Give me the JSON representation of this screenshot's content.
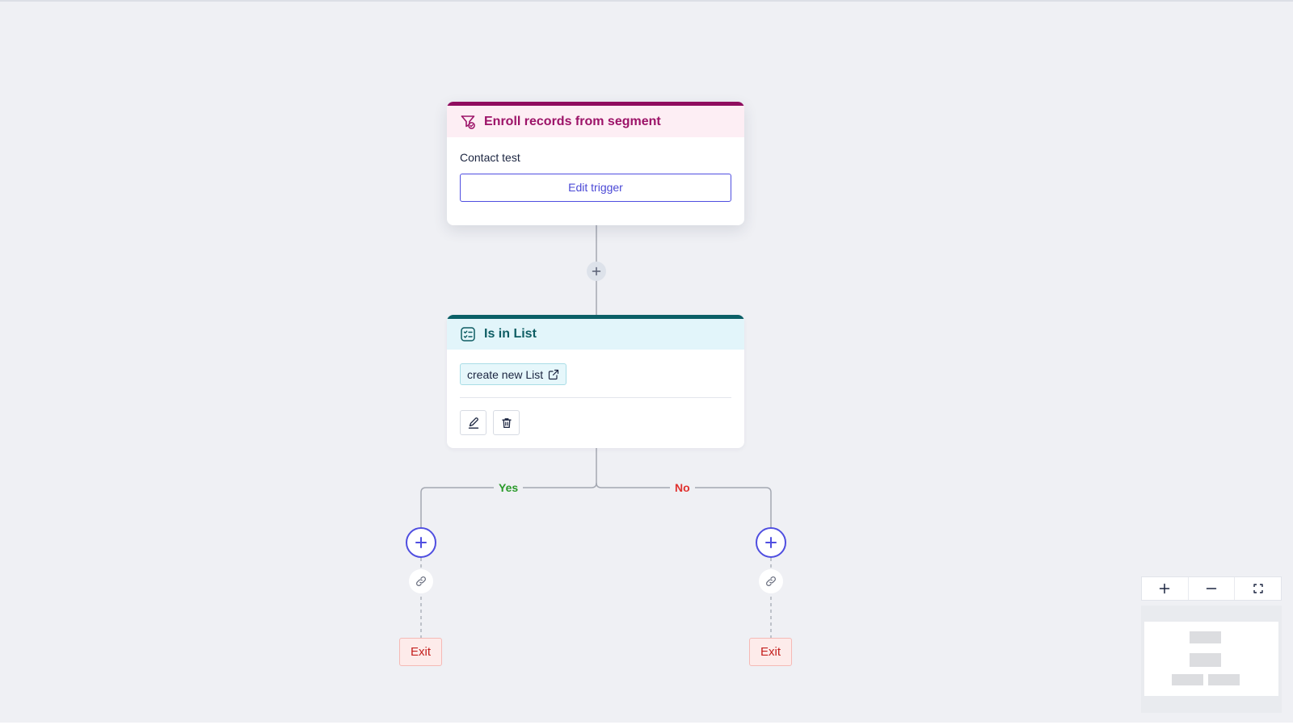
{
  "trigger": {
    "title": "Enroll records from segment",
    "segment_name": "Contact test",
    "edit_label": "Edit trigger",
    "icon": "segment-filter-icon"
  },
  "condition": {
    "title": "Is in List",
    "icon": "checklist-icon",
    "list_name": "create new List",
    "list_link_icon": "external-link-icon",
    "edit_icon": "pencil-icon",
    "delete_icon": "trash-icon"
  },
  "branches": {
    "yes_label": "Yes",
    "no_label": "No",
    "yes_exit": "Exit",
    "no_exit": "Exit"
  },
  "colors": {
    "trigger_accent": "#8f0d5f",
    "condition_accent": "#0b5f66",
    "primary": "#4f4ee0",
    "yes": "#2a9a2a",
    "no": "#e0322f",
    "exit": "#c4201f"
  },
  "zoom": {
    "zoom_in_icon": "plus-icon",
    "zoom_out_icon": "minus-icon",
    "fit_icon": "fit-screen-icon"
  }
}
